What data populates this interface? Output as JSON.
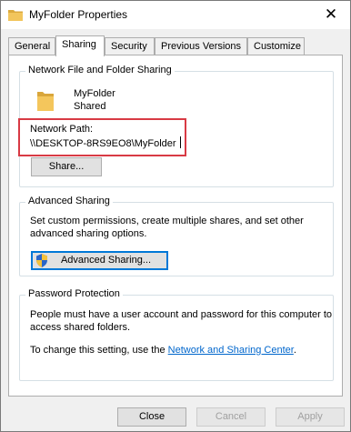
{
  "window": {
    "title": "MyFolder Properties",
    "close_glyph": "✕"
  },
  "tabs": [
    {
      "label": "General"
    },
    {
      "label": "Sharing"
    },
    {
      "label": "Security"
    },
    {
      "label": "Previous Versions"
    },
    {
      "label": "Customize"
    }
  ],
  "sharing": {
    "group_title": "Network File and Folder Sharing",
    "folder_name": "MyFolder",
    "folder_status": "Shared",
    "network_path_label": "Network Path:",
    "network_path_value": "\\\\DESKTOP-8RS9EO8\\MyFolder",
    "share_button": "Share..."
  },
  "advanced": {
    "group_title": "Advanced Sharing",
    "description": "Set custom permissions, create multiple shares, and set other advanced sharing options.",
    "description_line1": "Set custom permissions, create multiple shares, and set other",
    "description_line2": "advanced sharing options.",
    "button": "Advanced Sharing..."
  },
  "password": {
    "group_title": "Password Protection",
    "line1": "People must have a user account and password for this computer to",
    "line2": "access shared folders.",
    "change_prefix": "To change this setting, use the ",
    "link_text": "Network and Sharing Center",
    "change_suffix": "."
  },
  "footer": {
    "close": "Close",
    "cancel": "Cancel",
    "apply": "Apply"
  },
  "colors": {
    "highlight_box": "#d83a44",
    "link": "#0066cc",
    "folder": "#e8b94a",
    "focus": "#0078d7"
  },
  "icons": {
    "title": "folder-icon",
    "close": "close-icon",
    "folder": "folder-icon",
    "shield": "uac-shield-icon"
  }
}
